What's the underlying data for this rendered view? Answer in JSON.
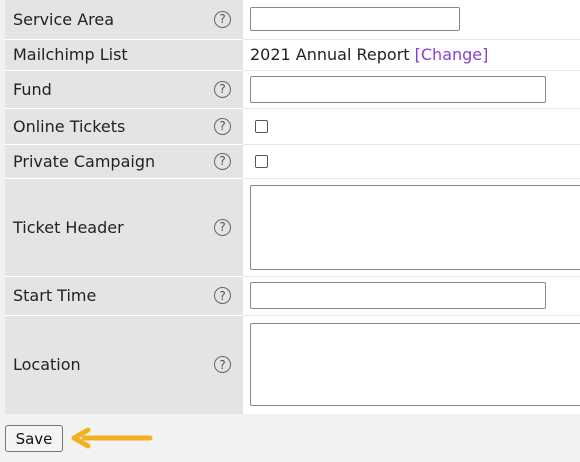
{
  "form": {
    "rows": [
      {
        "label": "Service Area"
      },
      {
        "label": "Mailchimp List",
        "value": "2021 Annual Report",
        "link": "[Change]"
      },
      {
        "label": "Fund"
      },
      {
        "label": "Online Tickets"
      },
      {
        "label": "Private Campaign"
      },
      {
        "label": "Ticket Header"
      },
      {
        "label": "Start Time"
      },
      {
        "label": "Location"
      }
    ],
    "help_glyph": "?"
  },
  "footer": {
    "save_label": "Save"
  },
  "colors": {
    "label_bg": "#e4e4e4",
    "link": "#8a3fd0",
    "arrow": "#f2b01e"
  },
  "icons": {
    "help": "question-circle-icon",
    "annotation": "arrow-left-icon"
  }
}
